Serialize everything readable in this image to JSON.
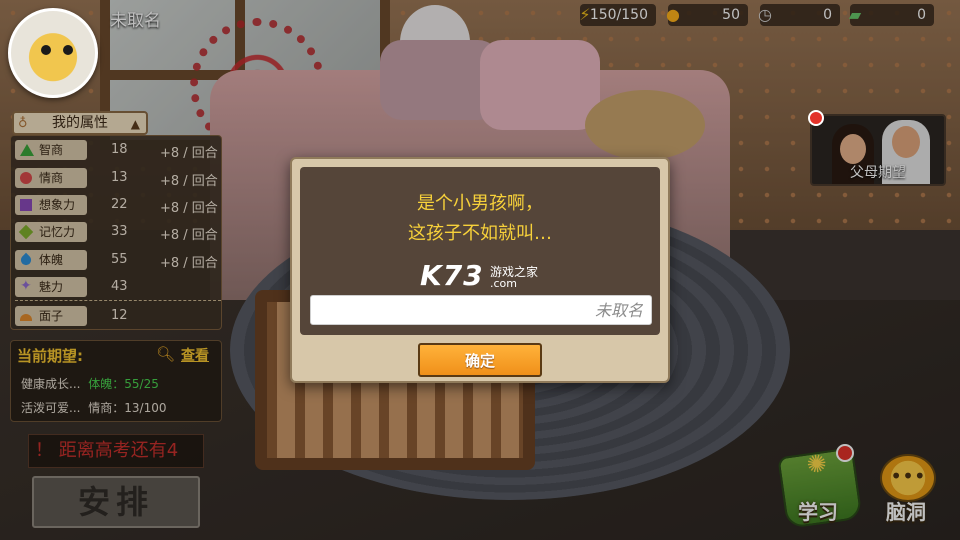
{
  "player": {
    "name": "未取名"
  },
  "resources": {
    "energy": "150/150",
    "coins": "50",
    "time": "0",
    "cash": "0"
  },
  "attributes": {
    "header": "我的属性",
    "items": [
      {
        "icon": "triangle-icon",
        "label": "智商",
        "value": "18",
        "rate": "+8 / 回合"
      },
      {
        "icon": "circle-icon",
        "label": "情商",
        "value": "13",
        "rate": "+8 / 回合"
      },
      {
        "icon": "square-icon",
        "label": "想象力",
        "value": "22",
        "rate": "+8 / 回合"
      },
      {
        "icon": "diamond-icon",
        "label": "记忆力",
        "value": "33",
        "rate": "+8 / 回合"
      },
      {
        "icon": "drop-icon",
        "label": "体魄",
        "value": "55",
        "rate": "+8 / 回合"
      },
      {
        "icon": "star-icon",
        "label": "魅力",
        "value": "43",
        "rate": ""
      },
      {
        "icon": "half-circle-icon",
        "label": "面子",
        "value": "12",
        "rate": ""
      }
    ]
  },
  "expectations": {
    "title": "当前期望:",
    "view_label": "查看",
    "items": [
      {
        "name": "健康成长...",
        "status": "体魄：55/25",
        "met": true
      },
      {
        "name": "活泼可爱...",
        "status": "情商：13/100",
        "met": false
      }
    ]
  },
  "countdown": {
    "text": "！ 距离高考还有4"
  },
  "arrange_button": "安排",
  "parents": {
    "label": "父母期望"
  },
  "bottom_buttons": {
    "study": "学习",
    "brainstorm": "脑洞"
  },
  "dialog": {
    "line1": "是个小男孩啊，",
    "line2": "这孩子不如就叫…",
    "input_value": "",
    "input_placeholder": "未取名",
    "confirm_label": "确定"
  },
  "watermark": {
    "logo": "K73",
    "site": "游戏之家",
    "domain": ".com"
  },
  "colors": {
    "accent_orange": "#f0901a",
    "dialog_text": "#f7d13a",
    "countdown_red": "#c8302c",
    "expect_ok_green": "#49d24f"
  }
}
